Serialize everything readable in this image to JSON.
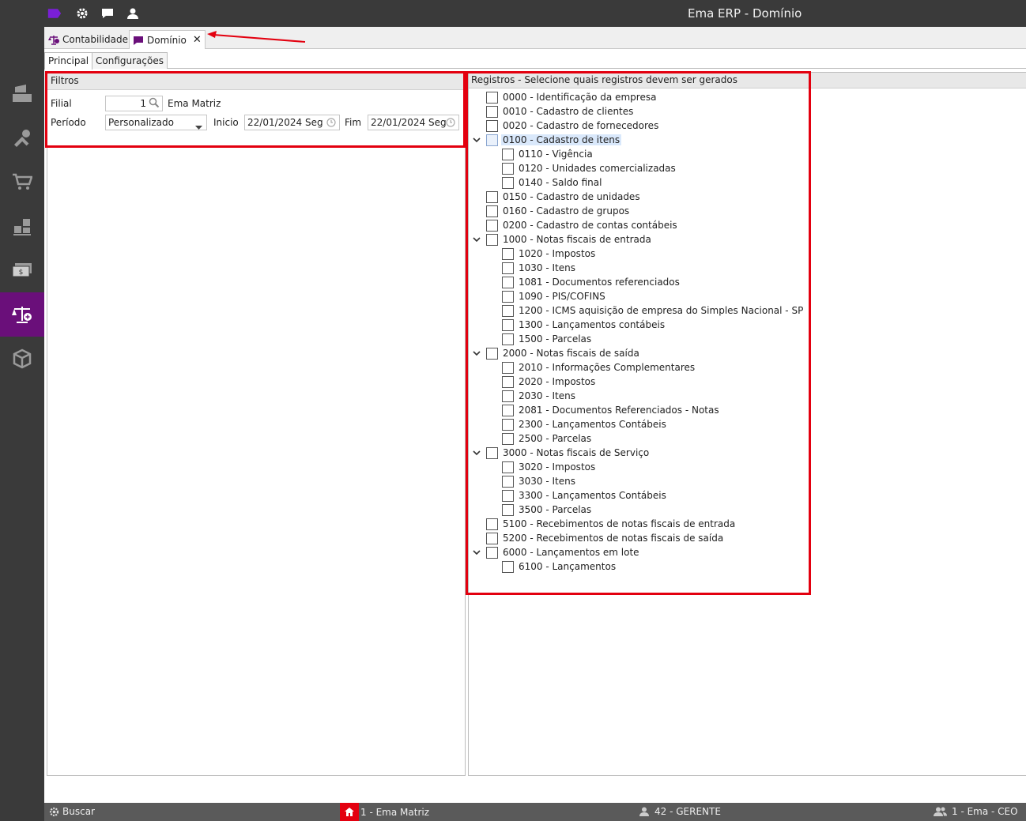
{
  "window": {
    "title": "Ema ERP - Domínio"
  },
  "titlebar_icons": [
    "tag-icon",
    "gear-icon",
    "chat-icon",
    "user-icon"
  ],
  "sidebar": {
    "items": [
      "cash-register-icon",
      "tools-icon",
      "cart-icon",
      "warehouse-icon",
      "money-icon",
      "scale-icon",
      "box-icon"
    ],
    "active": "scale-icon"
  },
  "doc_tabs": [
    {
      "label": "Contabilidade",
      "icon": "scale-icon"
    },
    {
      "label": "Domínio",
      "icon": "tag-icon",
      "close": "✕"
    }
  ],
  "sub_tabs": [
    {
      "label": "Principal"
    },
    {
      "label": "Configurações"
    }
  ],
  "filters": {
    "title": "Filtros",
    "filial_label": "Filial",
    "filial_value": "1",
    "filial_name": "Ema Matriz",
    "periodo_label": "Período",
    "periodo_value": "Personalizado",
    "inicio_label": "Inicio",
    "inicio_value": "22/01/2024 Seg",
    "fim_label": "Fim",
    "fim_value": "22/01/2024 Seg"
  },
  "registros": {
    "title": "Registros - Selecione quais registros devem ser gerados",
    "items": [
      {
        "label": "0000 - Identificação da empresa",
        "level": 0
      },
      {
        "label": "0010 - Cadastro de clientes",
        "level": 0
      },
      {
        "label": "0020 - Cadastro de fornecedores",
        "level": 0
      },
      {
        "label": "0100 - Cadastro de itens",
        "level": 0,
        "expanded": true,
        "selected": true
      },
      {
        "label": "0110 - Vigência",
        "level": 1
      },
      {
        "label": "0120 - Unidades comercializadas",
        "level": 1
      },
      {
        "label": "0140 - Saldo final",
        "level": 1
      },
      {
        "label": "0150 - Cadastro de unidades",
        "level": 0
      },
      {
        "label": "0160 - Cadastro de grupos",
        "level": 0
      },
      {
        "label": "0200 - Cadastro de contas contábeis",
        "level": 0
      },
      {
        "label": "1000 - Notas fiscais de entrada",
        "level": 0,
        "expanded": true
      },
      {
        "label": "1020 - Impostos",
        "level": 1
      },
      {
        "label": "1030 - Itens",
        "level": 1
      },
      {
        "label": "1081 - Documentos referenciados",
        "level": 1
      },
      {
        "label": "1090 - PIS/COFINS",
        "level": 1
      },
      {
        "label": "1200 - ICMS aquisição de empresa do Simples Nacional - SP",
        "level": 1
      },
      {
        "label": "1300 - Lançamentos contábeis",
        "level": 1
      },
      {
        "label": "1500 - Parcelas",
        "level": 1
      },
      {
        "label": "2000 - Notas fiscais de saída",
        "level": 0,
        "expanded": true
      },
      {
        "label": "2010 - Informações Complementares",
        "level": 1
      },
      {
        "label": "2020 - Impostos",
        "level": 1
      },
      {
        "label": "2030 - Itens",
        "level": 1
      },
      {
        "label": "2081 - Documentos Referenciados - Notas",
        "level": 1
      },
      {
        "label": "2300 - Lançamentos Contábeis",
        "level": 1
      },
      {
        "label": "2500 - Parcelas",
        "level": 1
      },
      {
        "label": "3000 - Notas fiscais de Serviço",
        "level": 0,
        "expanded": true
      },
      {
        "label": "3020 - Impostos",
        "level": 1
      },
      {
        "label": "3030 - Itens",
        "level": 1
      },
      {
        "label": "3300 - Lançamentos Contábeis",
        "level": 1
      },
      {
        "label": "3500 - Parcelas",
        "level": 1
      },
      {
        "label": "5100 - Recebimentos de notas fiscais de entrada",
        "level": 0
      },
      {
        "label": "5200 - Recebimentos de notas fiscais de saída",
        "level": 0
      },
      {
        "label": "6000 - Lançamentos em lote",
        "level": 0,
        "expanded": true
      },
      {
        "label": "6100 - Lançamentos",
        "level": 1
      }
    ]
  },
  "statusbar": {
    "search": "Buscar",
    "branch": "1 - Ema Matriz",
    "role": "42 - GERENTE",
    "user": "1 - Ema - CEO"
  },
  "colors": {
    "accent": "#6a0f7a",
    "highlight": "#e3000f",
    "chrome": "#3a3a3a"
  }
}
